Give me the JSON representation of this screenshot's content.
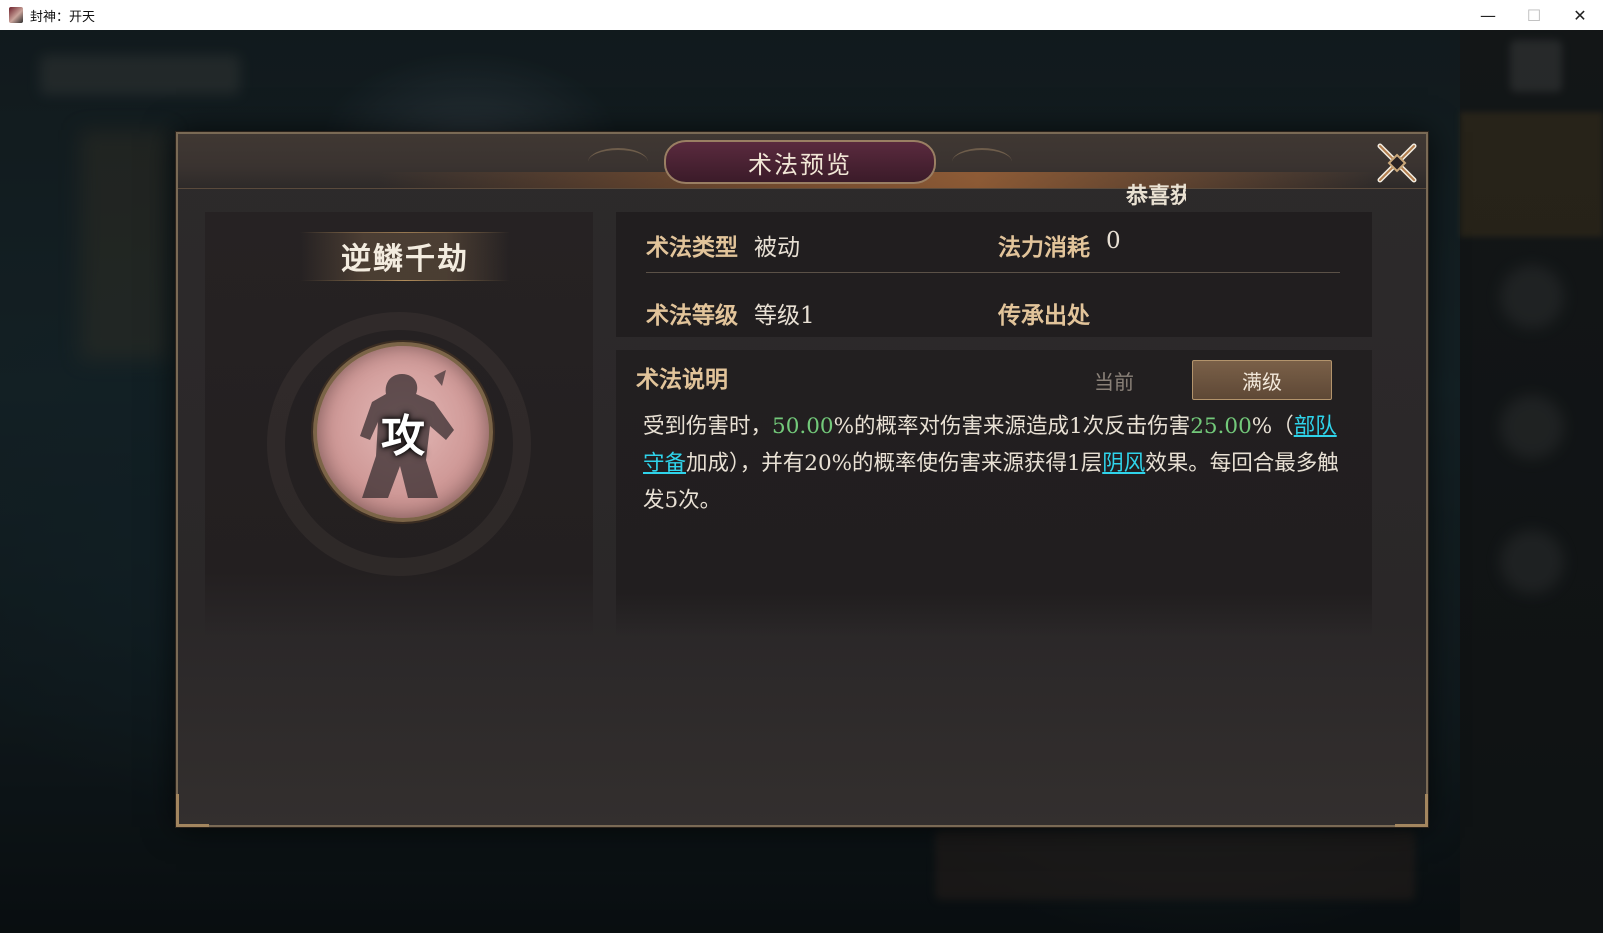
{
  "window": {
    "title": "封神：开天",
    "minimize": "—",
    "maximize": "☐",
    "close": "✕"
  },
  "modal": {
    "title": "术法预览",
    "congrats_text": "恭喜获得"
  },
  "skill": {
    "name": "逆鳞千劫",
    "icon_char": "攻"
  },
  "info": {
    "type_label": "术法类型",
    "type_value": "被动",
    "cost_label": "法力消耗",
    "cost_value": "0",
    "level_label": "术法等级",
    "level_value": "等级1",
    "source_label": "传承出处",
    "source_value": ""
  },
  "description": {
    "label": "术法说明",
    "tab_current": "当前",
    "tab_max": "满级",
    "parts": {
      "p1": "受到伤害时，",
      "n1": "50.00",
      "p2": "%的概率对伤害来源造成1次反击伤害",
      "n2": "25.00",
      "p3": "%（",
      "l1": "部队守备",
      "p4": "加成），并有20%的概率使伤害来源获得1层",
      "l2": "阴风",
      "p5": "效果。每回合最多触发5次。"
    }
  },
  "colors": {
    "highlight_number": "#73c97a",
    "link": "#2fd3ea",
    "label_gold": "#e2c49a"
  }
}
